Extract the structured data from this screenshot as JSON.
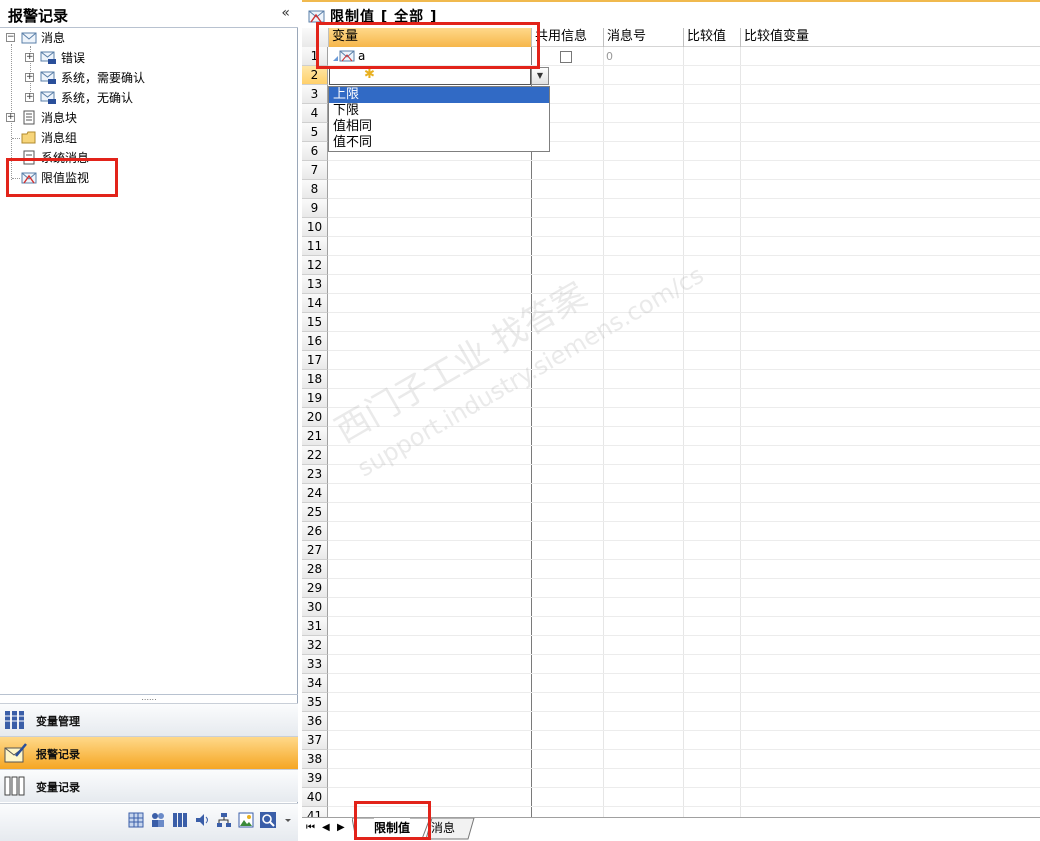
{
  "left": {
    "title": "报警记录",
    "collapse_glyph": "«",
    "tree": [
      {
        "label": "消息",
        "icon": "message-envelope-icon"
      },
      {
        "label": "错误",
        "icon": "message-class-icon"
      },
      {
        "label": "系统，需要确认",
        "icon": "message-class-icon"
      },
      {
        "label": "系统，无确认",
        "icon": "message-class-icon"
      },
      {
        "label": "消息块",
        "icon": "document-icon"
      },
      {
        "label": "消息组",
        "icon": "folder-icon"
      },
      {
        "label": "系统消息",
        "icon": "document-icon"
      },
      {
        "label": "限值监视",
        "icon": "limit-monitor-icon"
      }
    ],
    "splitter_glyph": "......",
    "nav": [
      {
        "label": "变量管理",
        "icon": "tag-management-icon"
      },
      {
        "label": "报警记录",
        "icon": "alarm-logging-icon"
      },
      {
        "label": "变量记录",
        "icon": "tag-logging-icon"
      }
    ],
    "toolbar_icons": [
      "grid-icon",
      "users-icon",
      "columns-icon",
      "speaker-icon",
      "network-icon",
      "image-icon",
      "search-icon",
      "more-arrow-icon"
    ]
  },
  "right": {
    "title": "限制值 [ 全部 ]",
    "columns": [
      "变量",
      "共用信息",
      "消息号",
      "比较值",
      "比较值变量"
    ],
    "row1": {
      "variable": "a",
      "message_no": "0"
    },
    "new_row_marker": "✱",
    "dropdown_options": [
      "上限",
      "下限",
      "值相同",
      "值不同"
    ],
    "dropdown_arrow": "▼",
    "row_count": 41,
    "tabs": [
      "限制值",
      "消息"
    ],
    "nav_glyphs": [
      "⏮",
      "◀",
      "▶"
    ]
  },
  "watermark": {
    "line1": "西门子工业  找答案",
    "line2": "support.industry.siemens.com/cs"
  },
  "colors": {
    "highlight_red": "#e2231a",
    "selection_blue": "#316ac5",
    "header_orange": "#f5a623"
  }
}
